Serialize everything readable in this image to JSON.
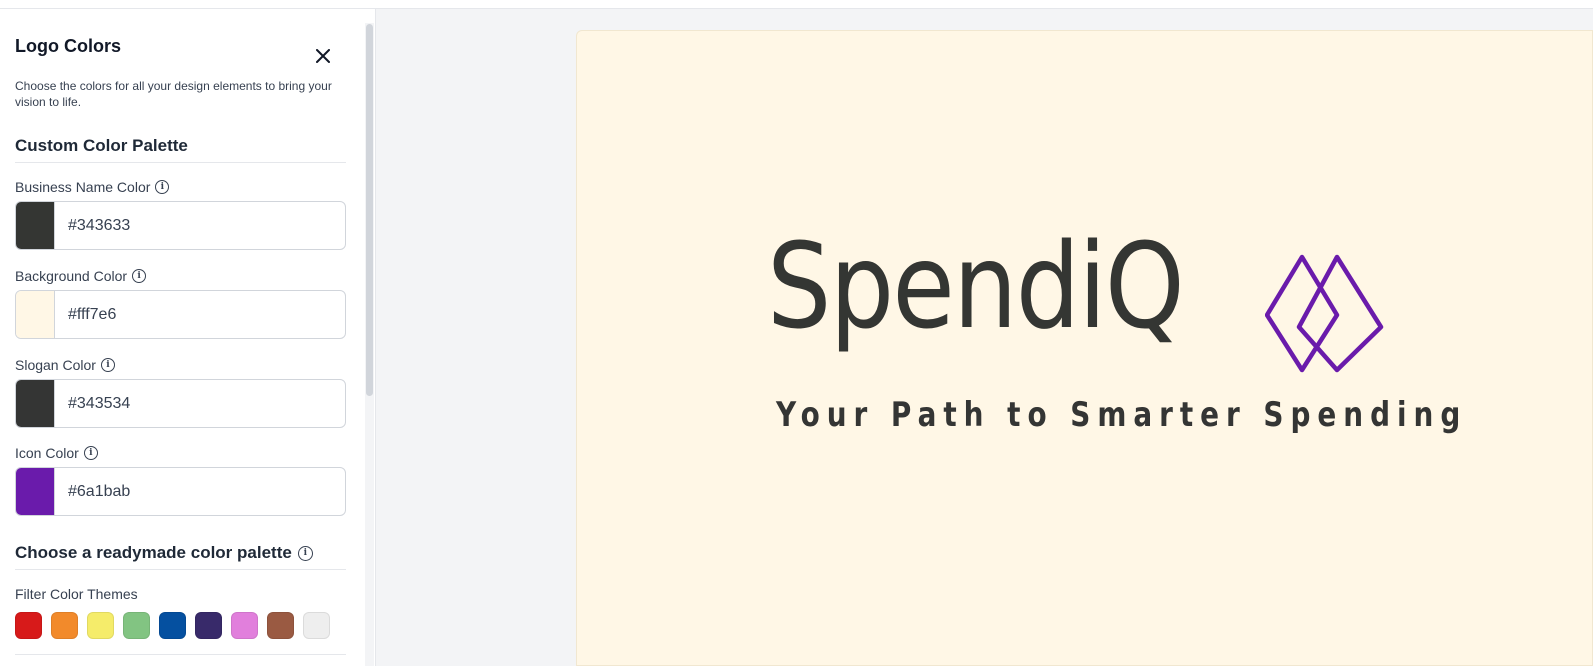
{
  "panel": {
    "title": "Logo Colors",
    "description": "Choose the colors for all your design elements to bring your vision to life.",
    "custom_section_title": "Custom Color Palette",
    "fields": [
      {
        "label": "Business Name Color",
        "value": "#343633",
        "swatch": "#343633"
      },
      {
        "label": "Background Color",
        "value": "#fff7e6",
        "swatch": "#fff7e6"
      },
      {
        "label": "Slogan Color",
        "value": "#343534",
        "swatch": "#343534"
      },
      {
        "label": "Icon Color",
        "value": "#6a1bab",
        "swatch": "#6a1bab"
      }
    ],
    "readymade_section_title": "Choose a readymade color palette",
    "filter_label": "Filter Color Themes",
    "theme_colors": [
      "#d71a1a",
      "#f28a2b",
      "#f5ec6a",
      "#82c482",
      "#0550a0",
      "#382a6a",
      "#e17fdc",
      "#9a5a42",
      "#eeeeee"
    ]
  },
  "preview": {
    "background": "#fff7e6",
    "business_name": "SpendiQ",
    "slogan": "Your Path to Smarter Spending",
    "name_color": "#343633",
    "slogan_color": "#343534",
    "icon_color": "#6a1bab",
    "icon": "double-diamond-icon"
  }
}
